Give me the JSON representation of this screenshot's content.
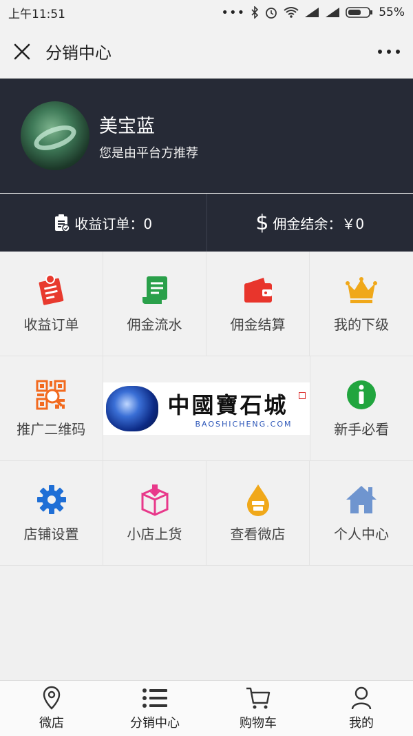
{
  "status_bar": {
    "time": "上午11:51",
    "battery": "55%"
  },
  "nav": {
    "title": "分销中心"
  },
  "profile": {
    "name": "美宝蓝",
    "subtitle": "您是由平台方推荐"
  },
  "stats": {
    "orders_label": "收益订单：0",
    "commission_label": "佣金结余：￥0"
  },
  "grid": {
    "items": [
      {
        "label": "收益订单",
        "icon": "orders-icon",
        "color": "#e83a2e"
      },
      {
        "label": "佣金流水",
        "icon": "scroll-icon",
        "color": "#2aa04a"
      },
      {
        "label": "佣金结算",
        "icon": "wallet-icon",
        "color": "#e8352c"
      },
      {
        "label": "我的下级",
        "icon": "crown-icon",
        "color": "#f0a81a"
      },
      {
        "label": "推广二维码",
        "icon": "qrcode-icon",
        "color": "#f26a1f"
      },
      {
        "label": "新手必看",
        "icon": "info-icon",
        "color": "#21a53e"
      },
      {
        "label": "店铺设置",
        "icon": "gear-icon",
        "color": "#1f6fd6"
      },
      {
        "label": "小店上货",
        "icon": "package-icon",
        "color": "#e8388a"
      },
      {
        "label": "查看微店",
        "icon": "drop-icon",
        "color": "#f0a81a"
      },
      {
        "label": "个人中心",
        "icon": "home-icon",
        "color": "#6f95cf"
      }
    ]
  },
  "banner": {
    "cn_text": "中國寶石城",
    "en_text": "BAOSHICHENG.COM"
  },
  "tabbar": {
    "items": [
      {
        "label": "微店",
        "icon": "location-icon"
      },
      {
        "label": "分销中心",
        "icon": "list-icon"
      },
      {
        "label": "购物车",
        "icon": "cart-icon"
      },
      {
        "label": "我的",
        "icon": "user-icon"
      }
    ]
  }
}
